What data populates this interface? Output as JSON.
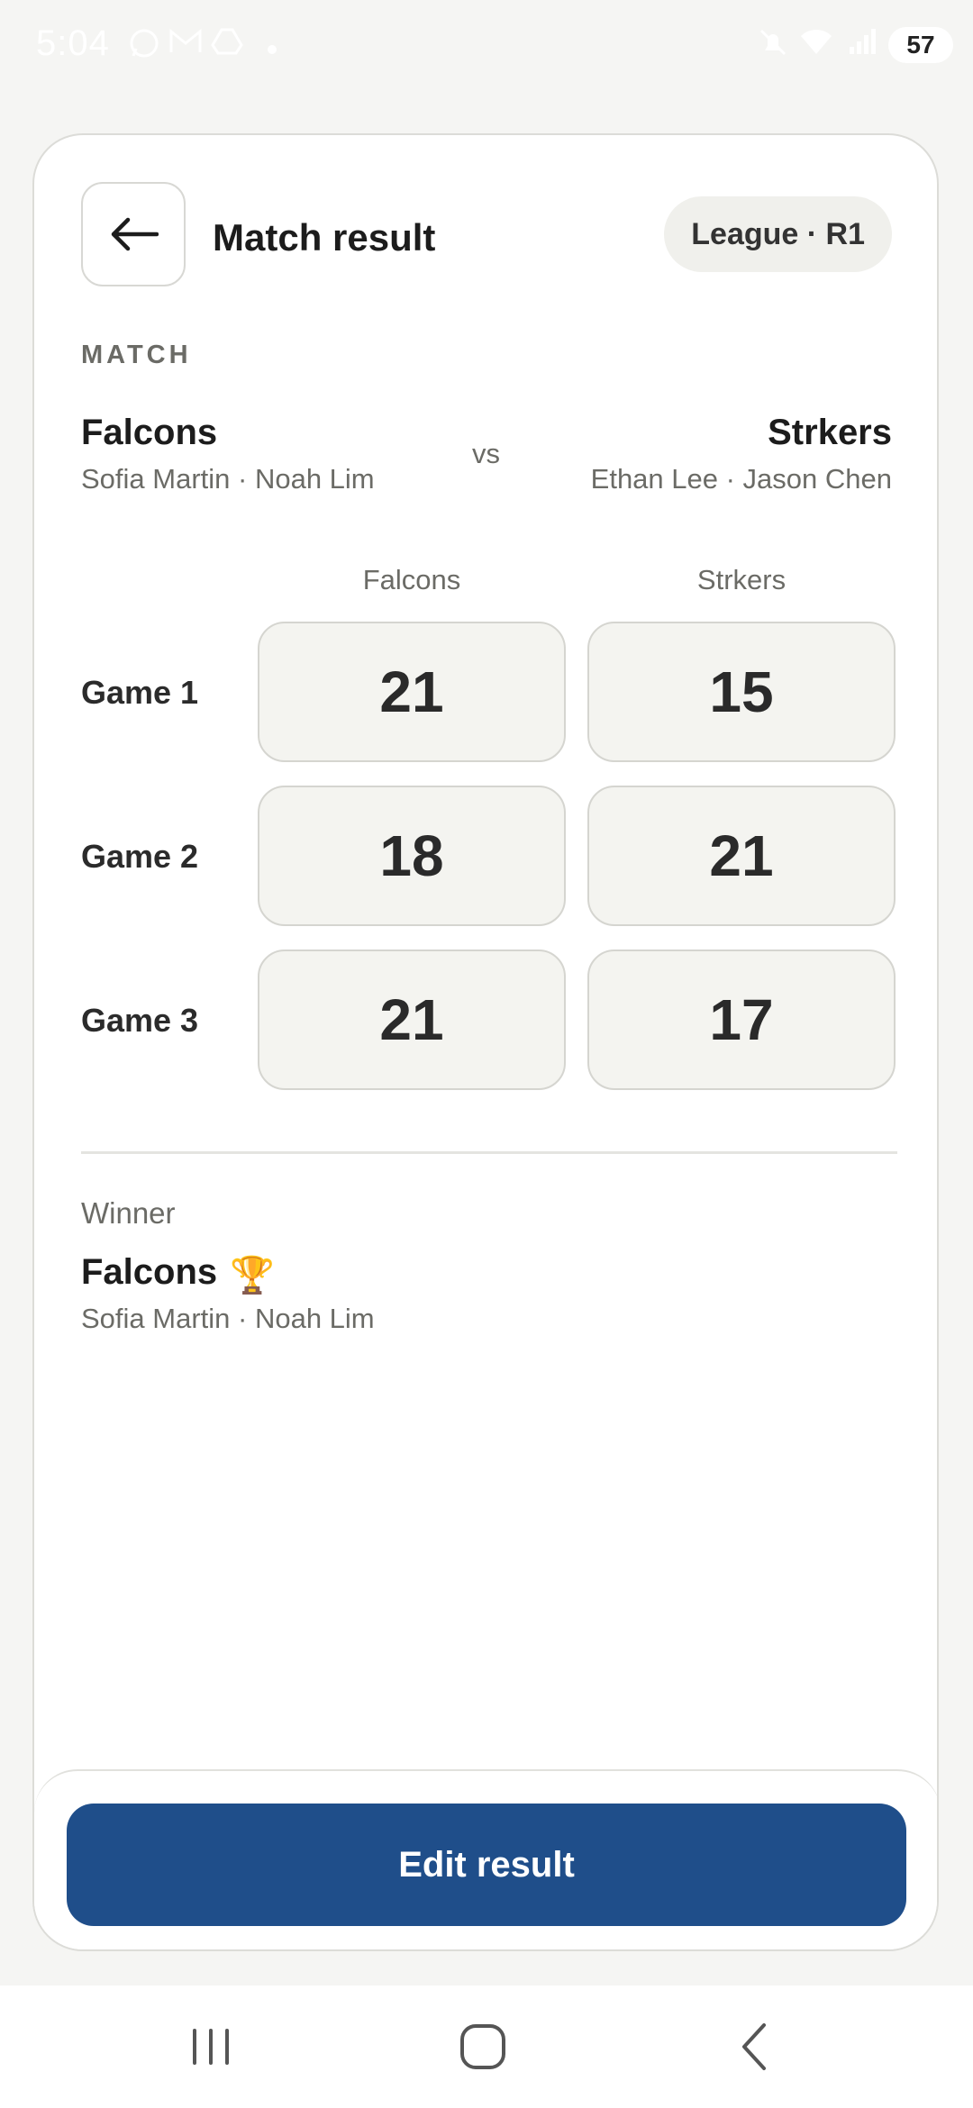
{
  "status_bar": {
    "time": "5:04",
    "battery": "57",
    "icons": [
      "whatsapp-icon",
      "gmail-icon",
      "drive-icon",
      "dot-icon",
      "mute-icon",
      "wifi-icon",
      "signal-icon"
    ]
  },
  "header": {
    "title": "Match result",
    "badge": "League · R1"
  },
  "match": {
    "section_label": "MATCH",
    "vs": "vs",
    "team_a": {
      "name": "Falcons",
      "players": "Sofia Martin · Noah Lim"
    },
    "team_b": {
      "name": "Strkers",
      "players": "Ethan Lee · Jason Chen"
    }
  },
  "scores": {
    "column_a": "Falcons",
    "column_b": "Strkers",
    "games": [
      {
        "label": "Game 1",
        "a": "21",
        "b": "15"
      },
      {
        "label": "Game 2",
        "a": "18",
        "b": "21"
      },
      {
        "label": "Game 3",
        "a": "21",
        "b": "17"
      }
    ]
  },
  "winner": {
    "label": "Winner",
    "name": "Falcons",
    "trophy": "🏆",
    "players": "Sofia Martin · Noah Lim"
  },
  "actions": {
    "edit_label": "Edit result"
  },
  "colors": {
    "accent": "#1f4e8a",
    "background": "#f5f5f3",
    "card": "#ffffff",
    "score_box": "#f4f4f0"
  }
}
